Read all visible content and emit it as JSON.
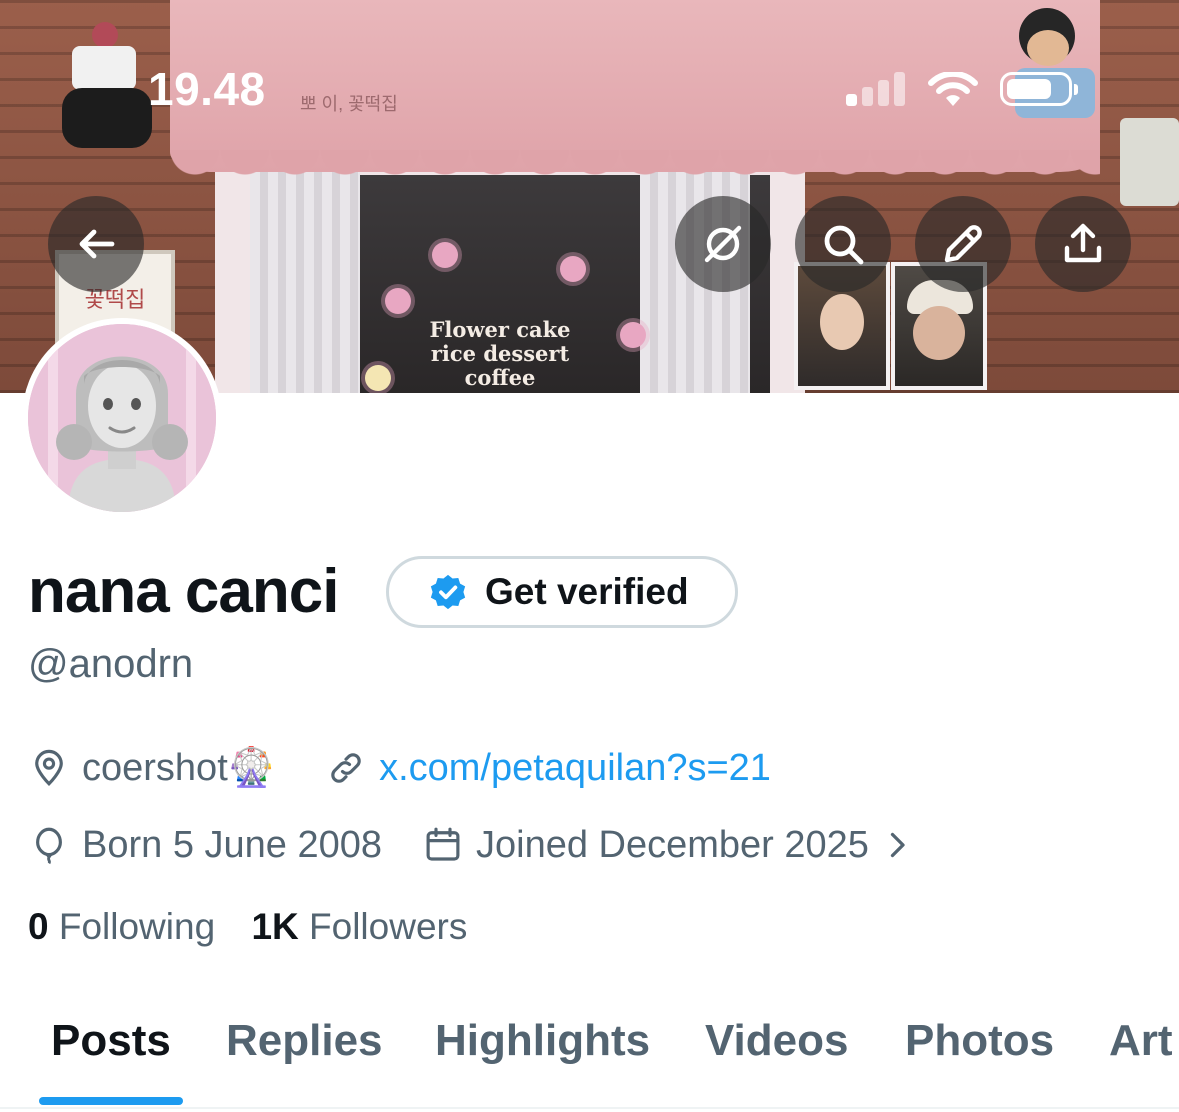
{
  "status_bar": {
    "time": "19.48"
  },
  "banner": {
    "awning_text": "뽀 이, 꽃떡집",
    "shop_sign_text": "꽃떡집",
    "window_text_line1": "Flower cake",
    "window_text_line2": "rice dessert",
    "window_text_line3": "coffee"
  },
  "header_buttons": {
    "back": "back-arrow-icon",
    "grok": "grok-icon",
    "search": "search-icon",
    "edit": "pencil-icon",
    "share": "share-icon"
  },
  "profile": {
    "display_name": "nana canci",
    "get_verified_label": "Get verified",
    "handle": "@anodrn",
    "location": "coershot🎡",
    "website": "x.com/petaquilan?s=21",
    "birthday": "Born 5 June 2008",
    "joined": "Joined December 2025",
    "following_count": "0",
    "following_label": "Following",
    "followers_count": "1K",
    "followers_label": "Followers"
  },
  "tabs": [
    "Posts",
    "Replies",
    "Highlights",
    "Videos",
    "Photos",
    "Art"
  ],
  "colors": {
    "accent": "#1d9bf0",
    "text": "#0f1419",
    "secondary": "#536471",
    "border": "#cfd9de"
  }
}
